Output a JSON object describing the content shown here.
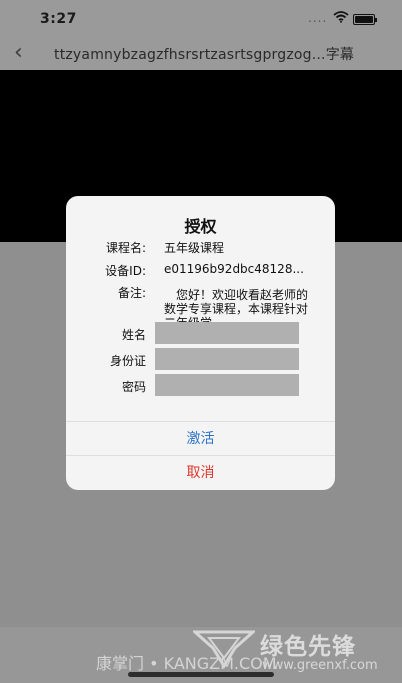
{
  "status_bar": {
    "time": "3:27",
    "signal": "...."
  },
  "nav": {
    "back_glyph": "‹",
    "title": "ttzyamnybzagzfhsrsrtzasrtsgprgzog...字幕"
  },
  "dialog": {
    "title": "授权",
    "course_label": "课程名:",
    "course_value": "五年级课程",
    "device_label": "设备ID:",
    "device_value": "e01196b92dbc48128...",
    "note_label": "备注:",
    "note_value": "您好！欢迎收看赵老师的数学专享课程，本课程针对二年级学",
    "form": {
      "name_label": "姓名",
      "name_value": "",
      "id_label": "身份证",
      "id_value": "",
      "password_label": "密码",
      "password_value": ""
    },
    "activate_label": "激活",
    "cancel_label": "取消"
  },
  "watermark": {
    "left_text": "康掌门 • KANGZM.COM",
    "brand": "绿色先锋",
    "url": "www.greenxf.com"
  },
  "colors": {
    "activate": "#2a72c9",
    "cancel": "#e0362c",
    "overlay": "#8f8f8f"
  }
}
